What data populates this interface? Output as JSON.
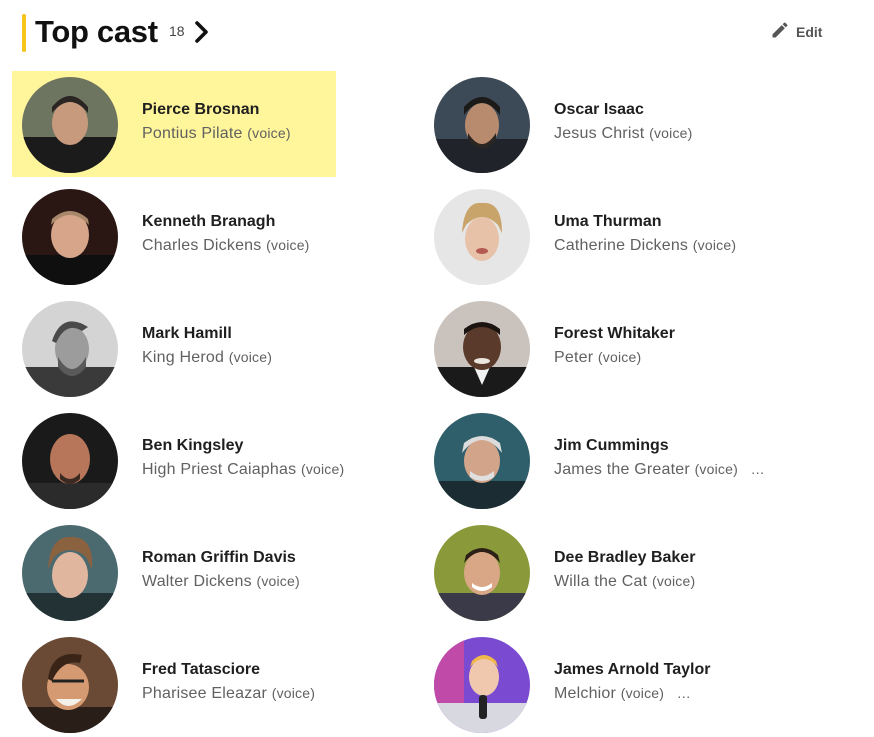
{
  "header": {
    "title": "Top cast",
    "count": "18",
    "chevron_icon": "chevron-right-icon",
    "edit_label": "Edit",
    "edit_icon": "pencil-icon",
    "accent_color": "#f5c518"
  },
  "highlight_color": "#fff59a",
  "cast": [
    {
      "name": "Pierce Brosnan",
      "character": "Pontius Pilate",
      "note": "(voice)",
      "more": ""
    },
    {
      "name": "Oscar Isaac",
      "character": "Jesus Christ",
      "note": "(voice)",
      "more": ""
    },
    {
      "name": "Kenneth Branagh",
      "character": "Charles Dickens",
      "note": "(voice)",
      "more": ""
    },
    {
      "name": "Uma Thurman",
      "character": "Catherine Dickens",
      "note": "(voice)",
      "more": ""
    },
    {
      "name": "Mark Hamill",
      "character": "King Herod",
      "note": "(voice)",
      "more": ""
    },
    {
      "name": "Forest Whitaker",
      "character": "Peter",
      "note": "(voice)",
      "more": ""
    },
    {
      "name": "Ben Kingsley",
      "character": "High Priest Caiaphas",
      "note": "(voice)",
      "more": ""
    },
    {
      "name": "Jim Cummings",
      "character": "James the Greater",
      "note": "(voice)",
      "more": "…"
    },
    {
      "name": "Roman Griffin Davis",
      "character": "Walter Dickens",
      "note": "(voice)",
      "more": ""
    },
    {
      "name": "Dee Bradley Baker",
      "character": "Willa the Cat",
      "note": "(voice)",
      "more": ""
    },
    {
      "name": "Fred Tatasciore",
      "character": "Pharisee Eleazar",
      "note": "(voice)",
      "more": ""
    },
    {
      "name": "James Arnold Taylor",
      "character": "Melchior",
      "note": "(voice)",
      "more": "…"
    }
  ]
}
